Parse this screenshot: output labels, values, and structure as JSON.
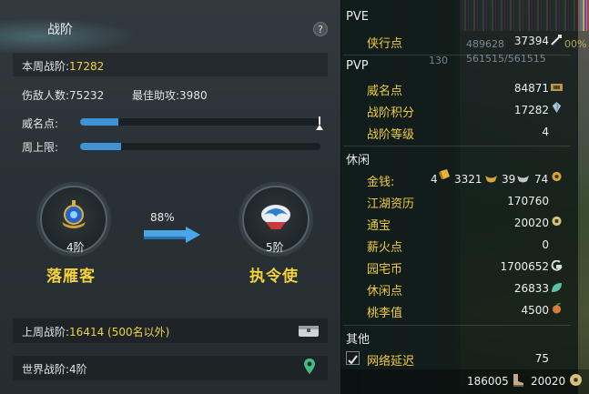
{
  "left": {
    "title": "战阶",
    "help": "?",
    "weekly_label": "本周战阶:",
    "weekly_value": "17282",
    "kills_label": "伤敌人数:",
    "kills_value": "75232",
    "assist_label": "最佳助攻:",
    "assist_value": "3980",
    "fame_label": "威名点:",
    "fame_progress": 0.16,
    "cap_label": "周上限:",
    "cap_progress": 0.17,
    "current_rank_num": "4阶",
    "current_rank_name": "落雁客",
    "next_rank_num": "5阶",
    "next_rank_name": "执令使",
    "progress_pct": "88%",
    "last_week_label": "上周战阶:",
    "last_week_value": "16414 (500名以外)",
    "world_label": "世界战阶:",
    "world_value": "4阶"
  },
  "right": {
    "pve_header": "PVE",
    "pve": [
      {
        "label": "侠行点",
        "value": "37394"
      }
    ],
    "pvp_header": "PVP",
    "pvp": [
      {
        "label": "威名点",
        "value": "84871"
      },
      {
        "label": "战阶积分",
        "value": "17282"
      },
      {
        "label": "战阶等级",
        "value": "4"
      }
    ],
    "leisure_header": "休闲",
    "money_label": "金钱:",
    "money_gold": "4",
    "money_silver": "3321",
    "money_copper": "39",
    "money_coin": "74",
    "leisure": [
      {
        "label": "江湖资历",
        "value": "170760"
      },
      {
        "label": "通宝",
        "value": "20020"
      },
      {
        "label": "薪火点",
        "value": "0"
      },
      {
        "label": "园宅币",
        "value": "1700652"
      },
      {
        "label": "休闲点",
        "value": "26833"
      },
      {
        "label": "桃李值",
        "value": "4500"
      }
    ],
    "other_header": "其他",
    "latency_label": "网络延迟",
    "latency_value": "75",
    "ghost_hp1": "489628",
    "ghost_hp2": "561515/561515",
    "ghost_pct": "00%",
    "ghost_lvl": "130",
    "footer_left": "186005",
    "footer_right": "20020"
  },
  "colors": {
    "accent_yellow": "#f1d43a",
    "bar_blue": "#3f93d4"
  }
}
